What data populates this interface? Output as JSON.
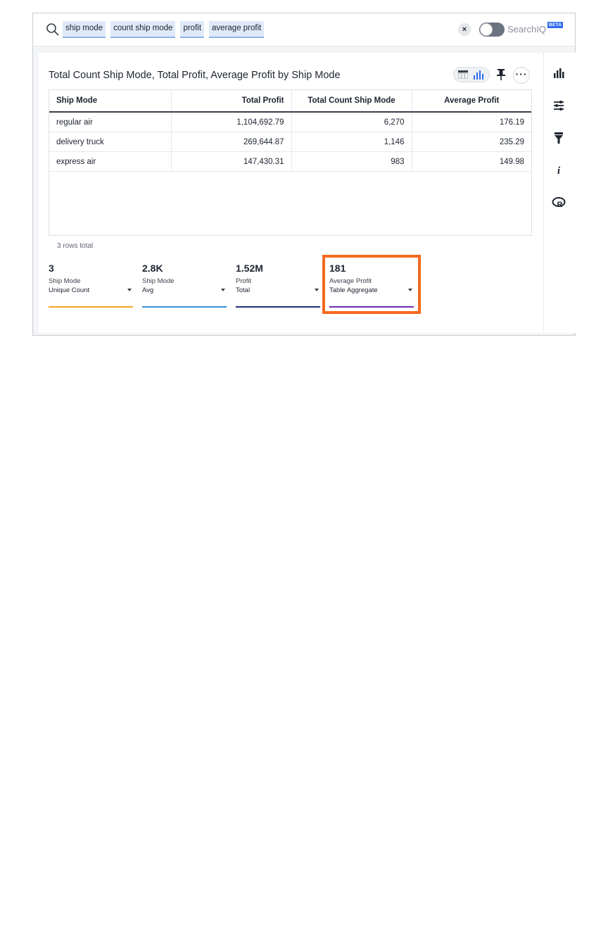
{
  "search": {
    "tokens": [
      "ship mode",
      "count ship mode",
      "profit",
      "average profit"
    ],
    "clear_label": "×",
    "searchiq_label": "SearchIQ",
    "beta_label": "BETA"
  },
  "answer": {
    "title": "Total Count Ship Mode, Total Profit, Average Profit by Ship Mode",
    "more_label": "···"
  },
  "table": {
    "headers": [
      "Ship Mode",
      "Total Profit",
      "Total Count Ship Mode",
      "Average Profit"
    ],
    "rows": [
      [
        "regular air",
        "1,104,692.79",
        "6,270",
        "176.19"
      ],
      [
        "delivery truck",
        "269,644.87",
        "1,146",
        "235.29"
      ],
      [
        "express air",
        "147,430.31",
        "983",
        "149.98"
      ]
    ],
    "row_count": "3 rows total"
  },
  "summaries": [
    {
      "value": "3",
      "label": "Ship Mode",
      "aggregation": "Unique Count",
      "color": "#f5a623"
    },
    {
      "value": "2.8K",
      "label": "Ship Mode",
      "aggregation": "Avg",
      "color": "#3b8fd6"
    },
    {
      "value": "1.52M",
      "label": "Profit",
      "aggregation": "Total",
      "color": "#1f2f7a"
    },
    {
      "value": "181",
      "label": "Average Profit",
      "aggregation": "Table Aggregate",
      "color": "#6b2fb3"
    }
  ],
  "colors": {
    "highlight": "#f46a1f",
    "accent": "#2f6bf0",
    "token_bg": "#dfe9f8"
  },
  "right_toolbar": [
    "chart-type-icon",
    "settings-icon",
    "filter-icon",
    "info-icon",
    "r-analysis-icon"
  ]
}
